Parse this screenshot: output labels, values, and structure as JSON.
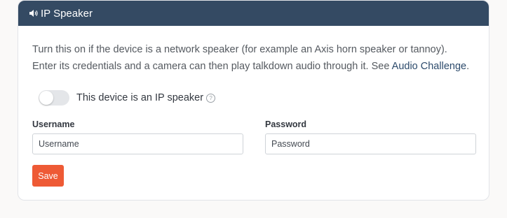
{
  "panel": {
    "title": "IP Speaker",
    "title_icon": "speaker-icon"
  },
  "description": {
    "text": "Turn this on if the device is a network speaker (for example an Axis horn speaker or tannoy). Enter its credentials and a camera can then play talkdown audio through it. See ",
    "link_label": "Audio Challenge",
    "after_link": "."
  },
  "toggle": {
    "label": "This device is an IP speaker",
    "checked": false,
    "help_icon": "question-circle-icon"
  },
  "username": {
    "label": "Username",
    "placeholder": "Username",
    "value": ""
  },
  "password": {
    "label": "Password",
    "placeholder": "Password",
    "value": ""
  },
  "save": {
    "label": "Save"
  },
  "colors": {
    "header_bg": "#344a63",
    "accent": "#ee5a35",
    "link": "#2c4a6b"
  }
}
